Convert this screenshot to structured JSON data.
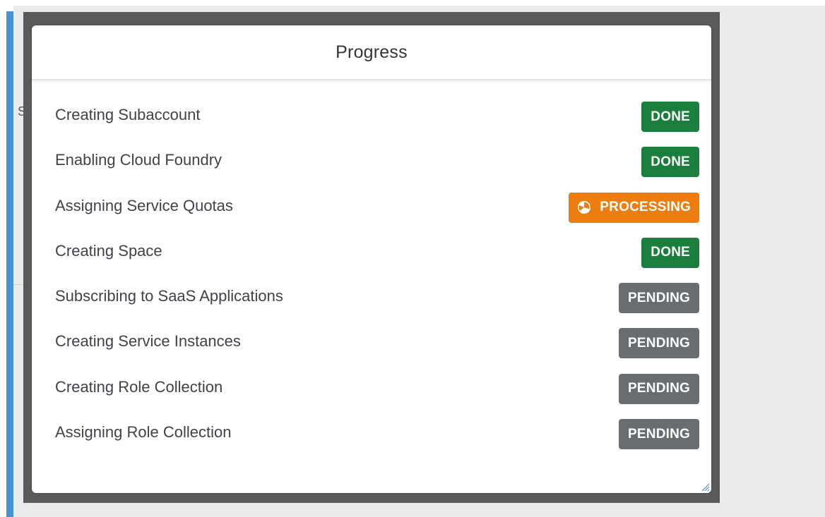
{
  "dialog": {
    "title": "Progress"
  },
  "background": {
    "fragment_text": "S"
  },
  "colors": {
    "done": "#1a7f3c",
    "processing": "#ee7d0f",
    "pending": "#6a6d70",
    "accent": "#4a93d1"
  },
  "steps": [
    {
      "label": "Creating Subaccount",
      "status": "DONE",
      "state": "done"
    },
    {
      "label": "Enabling Cloud Foundry",
      "status": "DONE",
      "state": "done"
    },
    {
      "label": "Assigning Service Quotas",
      "status": "PROCESSING",
      "state": "processing",
      "icon": "spinner-icon"
    },
    {
      "label": "Creating Space",
      "status": "DONE",
      "state": "done"
    },
    {
      "label": "Subscribing to SaaS Applications",
      "status": "PENDING",
      "state": "pending"
    },
    {
      "label": "Creating Service Instances",
      "status": "PENDING",
      "state": "pending"
    },
    {
      "label": "Creating Role Collection",
      "status": "PENDING",
      "state": "pending"
    },
    {
      "label": "Assigning Role Collection",
      "status": "PENDING",
      "state": "pending"
    }
  ]
}
